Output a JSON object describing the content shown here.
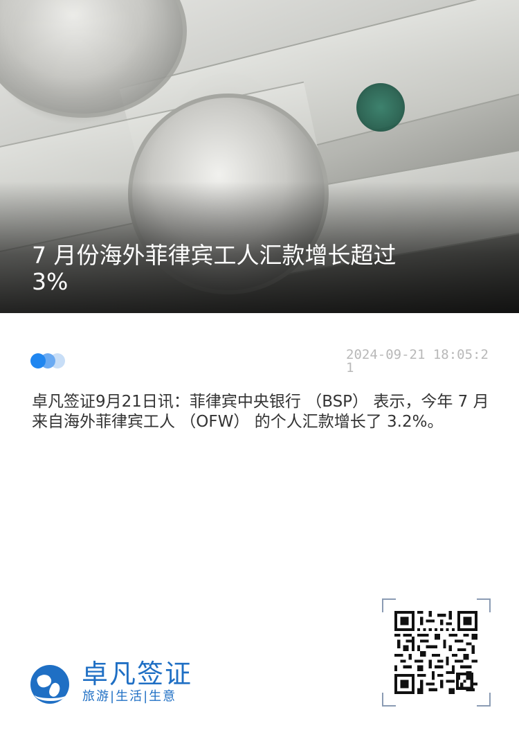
{
  "article": {
    "title": "7 月份海外菲律宾工人汇款增长超过 3%",
    "timestamp": "2024-09-21 18:05:21",
    "body": "卓凡签证9月21日讯：菲律宾中央银行 （BSP） 表示，今年 7 月来自海外菲律宾工人 （OFW） 的个人汇款增长了 3.2%。"
  },
  "hero": {
    "image": "dollar-bills-photo"
  },
  "meta": {
    "indicator_colors": [
      "#1f86f0",
      "#6aaaf2",
      "#c8def7"
    ]
  },
  "brand": {
    "name": "卓凡签证",
    "slogan": "旅游|生活|生意",
    "color": "#1f6fc4",
    "logo_icon": "globe-logo-icon"
  },
  "qr": {
    "icon": "qr-code-icon"
  }
}
